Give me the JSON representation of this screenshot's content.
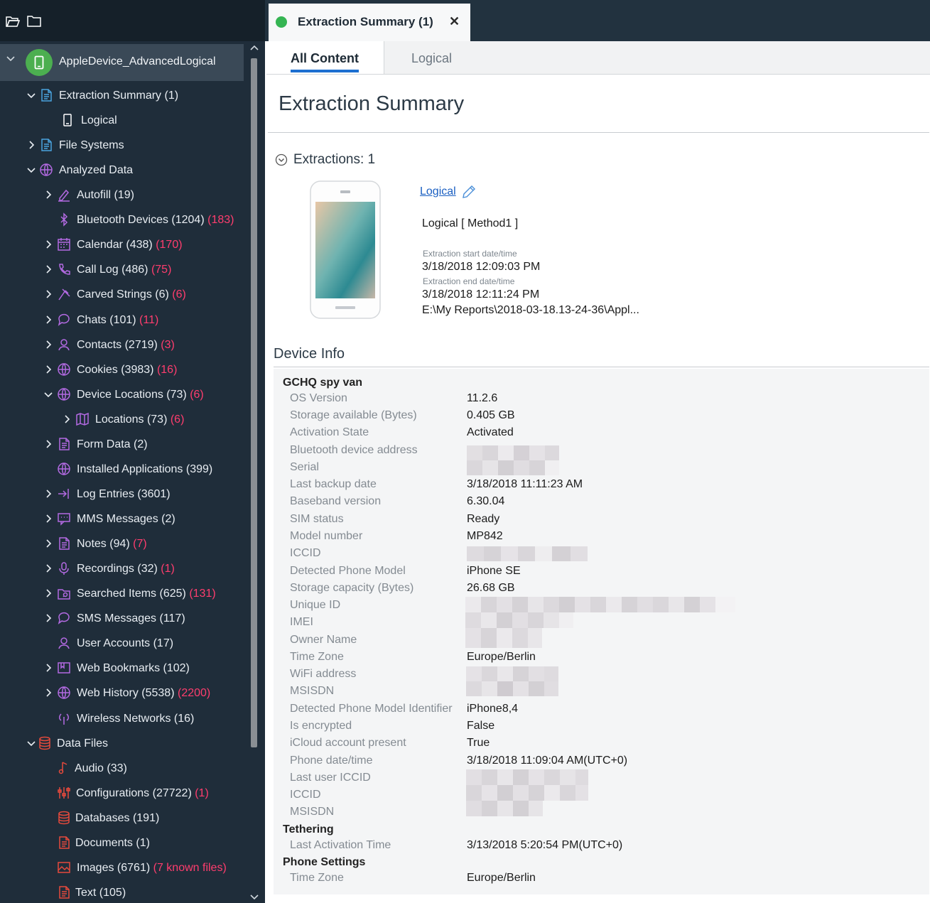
{
  "sidebar": {
    "device": {
      "label": "AppleDevice_AdvancedLogical"
    },
    "tree": [
      {
        "id": "extraction-summary",
        "label": "Extraction Summary (1)",
        "count": ""
      },
      {
        "id": "logical",
        "label": "Logical",
        "count": ""
      },
      {
        "id": "file-systems",
        "label": "File Systems",
        "count": ""
      },
      {
        "id": "analyzed-data",
        "label": "Analyzed Data",
        "count": ""
      },
      {
        "id": "autofill",
        "label": "Autofill (19)",
        "count": ""
      },
      {
        "id": "bluetooth-devices",
        "label": "Bluetooth Devices (1204)",
        "count": "(183)"
      },
      {
        "id": "calendar",
        "label": "Calendar (438)",
        "count": "(170)"
      },
      {
        "id": "call-log",
        "label": "Call Log (486)",
        "count": "(75)"
      },
      {
        "id": "carved-strings",
        "label": "Carved Strings (6)",
        "count": "(6)"
      },
      {
        "id": "chats",
        "label": "Chats (101)",
        "count": "(11)"
      },
      {
        "id": "contacts",
        "label": "Contacts (2719)",
        "count": "(3)"
      },
      {
        "id": "cookies",
        "label": "Cookies (3983)",
        "count": "(16)"
      },
      {
        "id": "device-locations",
        "label": "Device Locations (73)",
        "count": "(6)"
      },
      {
        "id": "locations",
        "label": "Locations (73)",
        "count": "(6)"
      },
      {
        "id": "form-data",
        "label": "Form Data (2)",
        "count": ""
      },
      {
        "id": "installed-applications",
        "label": "Installed Applications (399)",
        "count": ""
      },
      {
        "id": "log-entries",
        "label": "Log Entries (3601)",
        "count": ""
      },
      {
        "id": "mms-messages",
        "label": "MMS Messages (2)",
        "count": ""
      },
      {
        "id": "notes",
        "label": "Notes (94)",
        "count": "(7)"
      },
      {
        "id": "recordings",
        "label": "Recordings (32)",
        "count": "(1)"
      },
      {
        "id": "searched-items",
        "label": "Searched Items (625)",
        "count": "(131)"
      },
      {
        "id": "sms-messages",
        "label": "SMS Messages (117)",
        "count": ""
      },
      {
        "id": "user-accounts",
        "label": "User Accounts (17)",
        "count": ""
      },
      {
        "id": "web-bookmarks",
        "label": "Web Bookmarks (102)",
        "count": ""
      },
      {
        "id": "web-history",
        "label": "Web History (5538)",
        "count": "(2200)"
      },
      {
        "id": "wireless-networks",
        "label": "Wireless Networks (16)",
        "count": ""
      },
      {
        "id": "data-files",
        "label": "Data Files",
        "count": ""
      },
      {
        "id": "audio",
        "label": "Audio (33)",
        "count": ""
      },
      {
        "id": "configurations",
        "label": "Configurations (27722)",
        "count": "(1)"
      },
      {
        "id": "databases",
        "label": "Databases (191)",
        "count": ""
      },
      {
        "id": "documents",
        "label": "Documents (1)",
        "count": ""
      },
      {
        "id": "images",
        "label": "Images (6761)",
        "count": "(7 known files)"
      },
      {
        "id": "text",
        "label": "Text (105)",
        "count": ""
      }
    ]
  },
  "tabbar": {
    "doc_tab_label": "Extraction Summary (1)",
    "close_glyph": "✕"
  },
  "content_tabs": {
    "all": "All Content",
    "logical": "Logical"
  },
  "page": {
    "title": "Extraction Summary",
    "extractions_heading": "Extractions: 1",
    "extraction": {
      "link": "Logical",
      "method": "Logical [ Method1 ]",
      "start_label": "Extraction start date/time",
      "start_value": "3/18/2018 12:09:03 PM",
      "end_label": "Extraction end date/time",
      "end_value": "3/18/2018 12:11:24 PM",
      "path": "E:\\My Reports\\2018-03-18.13-24-36\\Appl..."
    },
    "device_info_heading": "Device Info",
    "groups": {
      "g1": "GCHQ spy van",
      "g2": "Tethering",
      "g3": "Phone Settings"
    },
    "props": [
      {
        "key": "OS Version",
        "value": "11.2.6"
      },
      {
        "key": "Storage available (Bytes)",
        "value": "0.405 GB"
      },
      {
        "key": "Activation State",
        "value": "Activated"
      },
      {
        "key": "Bluetooth device address",
        "value": ""
      },
      {
        "key": "Serial",
        "value": ""
      },
      {
        "key": "Last backup date",
        "value": "3/18/2018 11:11:23 AM"
      },
      {
        "key": "Baseband version",
        "value": "6.30.04"
      },
      {
        "key": "SIM status",
        "value": "Ready"
      },
      {
        "key": "Model number",
        "value": "MP842"
      },
      {
        "key": "ICCID",
        "value": ""
      },
      {
        "key": "Detected Phone Model",
        "value": "iPhone SE"
      },
      {
        "key": "Storage capacity (Bytes)",
        "value": "26.68 GB"
      },
      {
        "key": "Unique ID",
        "value": ""
      },
      {
        "key": "IMEI",
        "value": ""
      },
      {
        "key": "Owner Name",
        "value": ""
      },
      {
        "key": "Time Zone",
        "value": "Europe/Berlin"
      },
      {
        "key": "WiFi address",
        "value": ""
      },
      {
        "key": "MSISDN",
        "value": ""
      },
      {
        "key": "Detected Phone Model Identifier",
        "value": "iPhone8,4"
      },
      {
        "key": "Is encrypted",
        "value": "False"
      },
      {
        "key": "iCloud account present",
        "value": "True"
      },
      {
        "key": "Phone date/time",
        "value": "3/18/2018 11:09:04 AM(UTC+0)"
      },
      {
        "key": "Last user ICCID",
        "value": ""
      },
      {
        "key": "ICCID",
        "value": ""
      },
      {
        "key": "MSISDN",
        "value": ""
      },
      {
        "key": "Last Activation Time",
        "value": "3/13/2018 5:20:54 PM(UTC+0)"
      },
      {
        "key": "Time Zone",
        "value": "Europe/Berlin"
      }
    ]
  },
  "colors": {
    "sidebar_bg": "#1f2d3a",
    "count_red": "#ff3d6e",
    "icon_blue": "#4aa3df",
    "icon_violet": "#b36ae2",
    "icon_red": "#e64a3c",
    "accent_green": "#35b553",
    "link_blue": "#1a5fc2"
  }
}
